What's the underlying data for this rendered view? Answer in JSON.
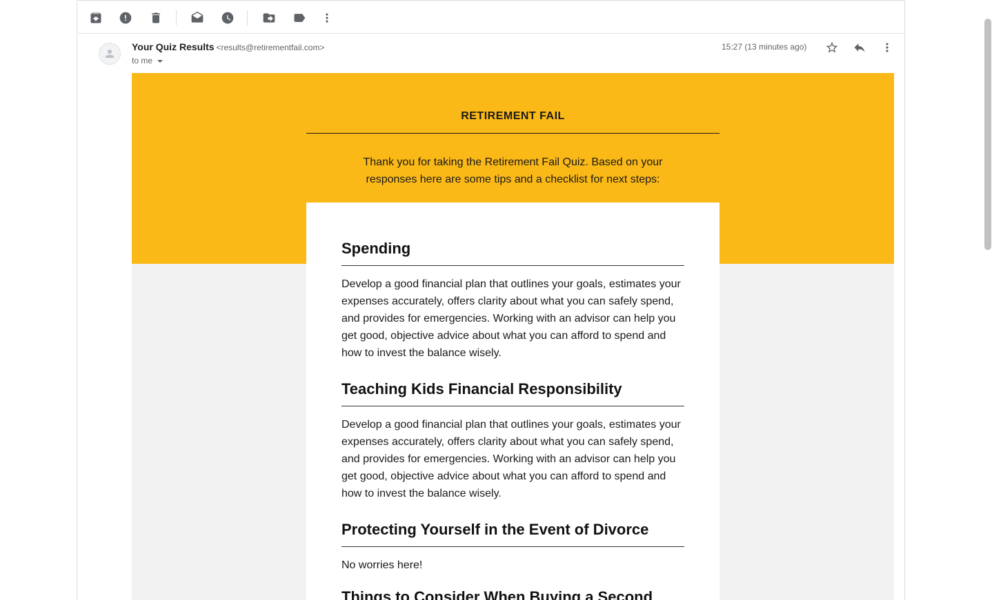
{
  "toolbar": {
    "icons": [
      "archive-icon",
      "report-spam-icon",
      "delete-icon",
      "mark-unread-icon",
      "snooze-icon",
      "move-to-icon",
      "label-icon",
      "more-vert-icon"
    ]
  },
  "message": {
    "sender_name": "Your Quiz Results",
    "sender_email": "<results@retirementfail.com>",
    "to_label": "to me",
    "timestamp": "15:27 (13 minutes ago)"
  },
  "email": {
    "brand": "RETIREMENT FAIL",
    "intro": "Thank you for taking the Retirement Fail Quiz. Based on your responses here are some tips and a checklist for next steps:",
    "sections": [
      {
        "heading": "Spending",
        "body": "Develop a good financial plan that outlines your goals, estimates your expenses accurately, offers clarity about what you can safely spend, and provides for emergencies. Working with an advisor can help you get good, objective advice about what you can afford to spend and how to invest the balance wisely."
      },
      {
        "heading": "Teaching Kids Financial Responsibility",
        "body": "Develop a good financial plan that outlines your goals, estimates your expenses accurately, offers clarity about what you can safely spend, and provides for emergencies. Working with an advisor can help you get good, objective advice about what you can afford to spend and how to invest the balance wisely."
      },
      {
        "heading": "Protecting Yourself in the Event of Divorce",
        "body": "No worries here!"
      },
      {
        "heading": "Things to Consider When Buying a Second",
        "body": ""
      }
    ]
  },
  "colors": {
    "banner": "#fbb917",
    "body_bg": "#f2f2f2"
  }
}
